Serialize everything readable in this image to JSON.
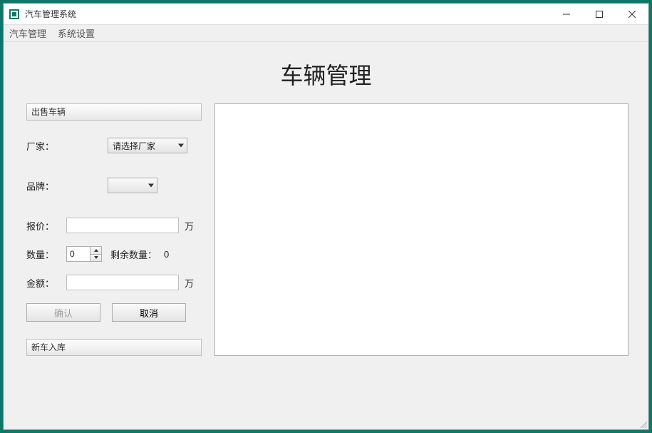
{
  "window": {
    "title": "汽车管理系统"
  },
  "menu": {
    "items": [
      "汽车管理",
      "系统设置"
    ]
  },
  "page": {
    "title": "车辆管理"
  },
  "sections": {
    "sell_header": "出售车辆",
    "new_car_header": "新车入库"
  },
  "form": {
    "manufacturer_label": "厂家：",
    "manufacturer_selected": "请选择厂家",
    "brand_label": "品牌：",
    "brand_selected": "",
    "price_label": "报价：",
    "price_value": "",
    "price_unit": "万",
    "quantity_label": "数量：",
    "quantity_value": "0",
    "remaining_label": "剩余数量：",
    "remaining_value": "0",
    "amount_label": "金额：",
    "amount_value": "",
    "amount_unit": "万"
  },
  "buttons": {
    "confirm": "确认",
    "cancel": "取消"
  }
}
